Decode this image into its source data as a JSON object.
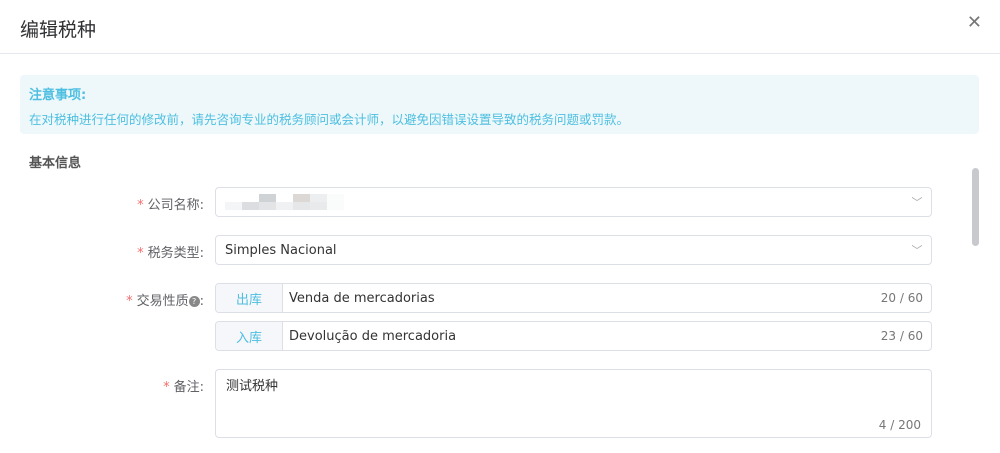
{
  "dialog": {
    "title": "编辑税种",
    "close_icon": "close-icon"
  },
  "notice": {
    "title": "注意事项:",
    "text": "在对税种进行任何的修改前，请先咨询专业的税务顾问或会计师，以避免因错误设置导致的税务问题或罚款。"
  },
  "section": {
    "title": "基本信息"
  },
  "form": {
    "required_mark": "*",
    "company": {
      "label": "公司名称:",
      "value_redacted": true
    },
    "tax_type": {
      "label": "税务类型:",
      "value": "Simples Nacional"
    },
    "transaction": {
      "label": "交易性质",
      "colon": ":",
      "help_icon": "question-circle-icon",
      "outbound": {
        "prefix": "出库",
        "value": "Venda de mercadorias",
        "count": "20 / 60"
      },
      "inbound": {
        "prefix": "入库",
        "value": "Devolução de mercadoria",
        "count": "23 / 60"
      }
    },
    "remark": {
      "label": "备注:",
      "value": "测试税种",
      "count": "4 / 200"
    }
  },
  "colors": {
    "accent": "#4ebfe0",
    "notice_bg": "#eef8fb",
    "required": "#f56c6c"
  }
}
